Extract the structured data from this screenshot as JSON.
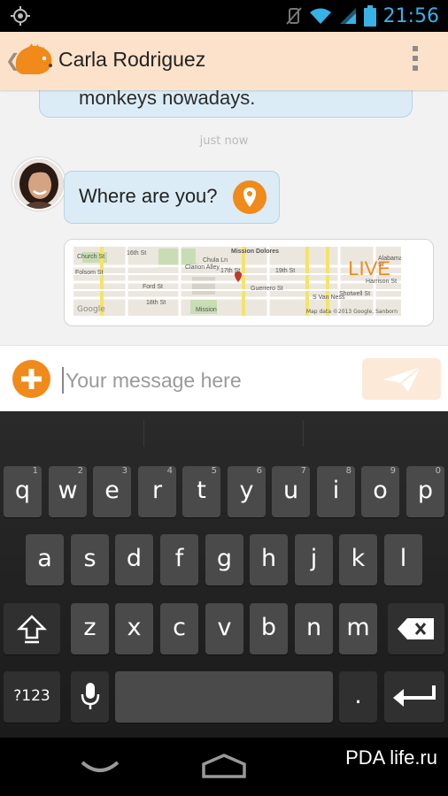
{
  "status_bar": {
    "time": "21:56",
    "icons": [
      "location-icon",
      "vibrate-icon",
      "wifi-icon",
      "signal-icon",
      "battery-icon"
    ]
  },
  "app_bar": {
    "title": "Carla Rodriguez",
    "icons": [
      "back-icon",
      "hedgehog-logo-icon",
      "overflow-menu-icon"
    ]
  },
  "messages": {
    "partial_top_text": "monkeys nowadays.",
    "timestamp": "just now",
    "where_text": "Where are you?",
    "map": {
      "live_label": "LIVE",
      "google_label": "Google",
      "credit": "Map data ©2013 Google, Sanborn",
      "street_labels": [
        "16th St",
        "17th St",
        "18th St",
        "Mission Dolores",
        "Clarion Alley",
        "Ford St",
        "Chula Ln",
        "Guerrero St",
        "Mission",
        "S Van Ness",
        "Shotwell St",
        "Harrison St",
        "Alabama St",
        "Folsom St",
        "19th St",
        "Church St"
      ]
    }
  },
  "composer": {
    "placeholder": "Your message here"
  },
  "keyboard": {
    "row1": [
      {
        "k": "q",
        "h": "1"
      },
      {
        "k": "w",
        "h": "2"
      },
      {
        "k": "e",
        "h": "3"
      },
      {
        "k": "r",
        "h": "4"
      },
      {
        "k": "t",
        "h": "5"
      },
      {
        "k": "y",
        "h": "6"
      },
      {
        "k": "u",
        "h": "7"
      },
      {
        "k": "i",
        "h": "8"
      },
      {
        "k": "o",
        "h": "9"
      },
      {
        "k": "p",
        "h": "0"
      }
    ],
    "row2": [
      "a",
      "s",
      "d",
      "f",
      "g",
      "h",
      "j",
      "k",
      "l"
    ],
    "row3": [
      "z",
      "x",
      "c",
      "v",
      "b",
      "n",
      "m"
    ],
    "numbers_label": "?123",
    "period_label": "."
  },
  "watermark": "PDA life.ru"
}
